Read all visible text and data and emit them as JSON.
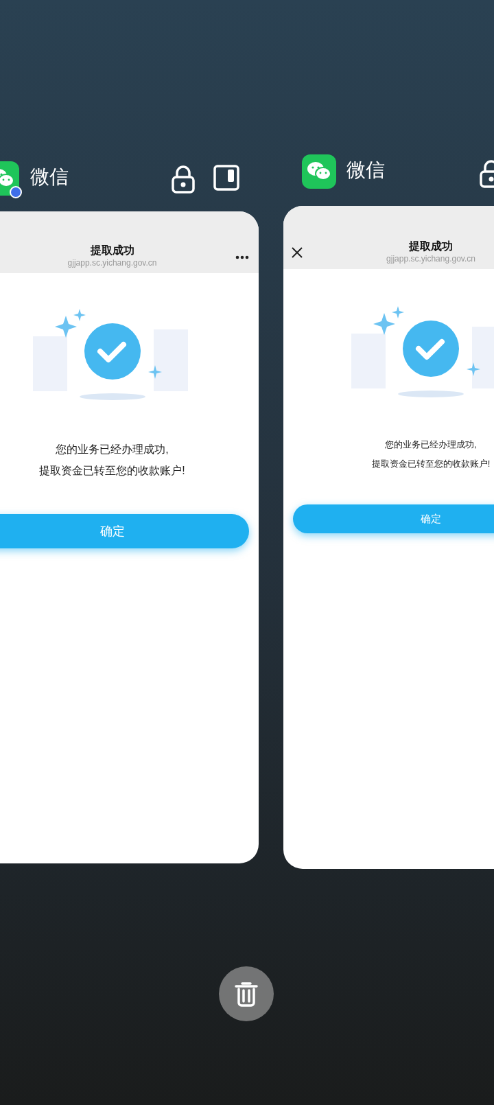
{
  "cards": [
    {
      "app_name": "微信",
      "clone_badge": true,
      "actions": [
        {
          "kind": "lock"
        },
        {
          "kind": "split"
        }
      ],
      "header_control": {
        "kind": "menu"
      },
      "title": "提取成功",
      "url": "gjjapp.sc.yichang.gov.cn",
      "message_lines": [
        "您的业务已经办理成功,",
        "提取资金已转至您的收款账户!"
      ],
      "button": "确定"
    },
    {
      "app_name": "微信",
      "clone_badge": false,
      "actions": [
        {
          "kind": "lock"
        }
      ],
      "header_control": {
        "kind": "close"
      },
      "title": "提取成功",
      "url": "gjjapp.sc.yichang.gov.cn",
      "message_lines": [
        "您的业务已经办理成功,",
        "提取资金已转至您的收款账户!"
      ],
      "button": "确定"
    }
  ]
}
